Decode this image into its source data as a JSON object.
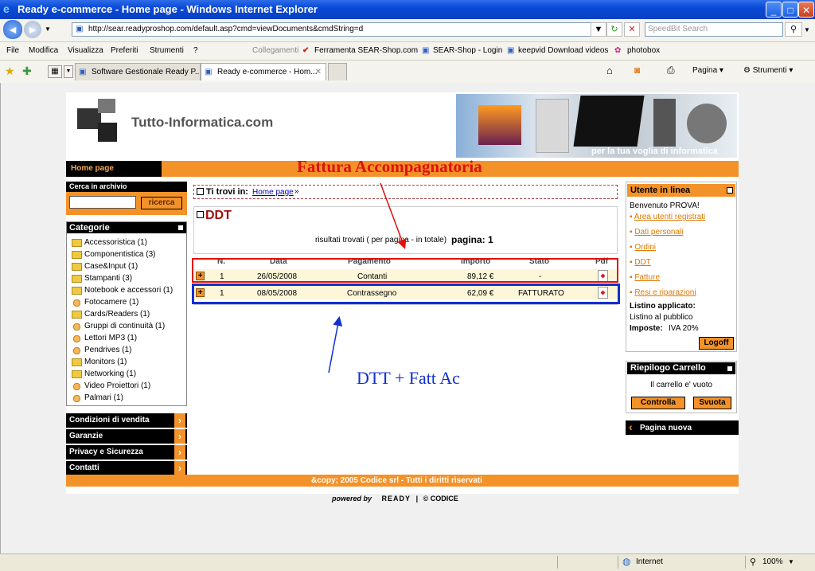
{
  "window": {
    "title": "Ready e-commerce - Home page - Windows Internet Explorer"
  },
  "addressbar": {
    "url": "http://sear.readyproshop.com/default.asp?cmd=viewDocuments&cmdString=d",
    "search_placeholder": "SpeedBit Search"
  },
  "menubar": {
    "items": [
      "File",
      "Modifica",
      "Visualizza",
      "Preferiti",
      "Strumenti",
      "?"
    ],
    "links_label": "Collegamenti",
    "links": [
      "Ferramenta SEAR-Shop.com",
      "SEAR-Shop - Login",
      "keepvid Download videos",
      "photobox"
    ]
  },
  "tabs": {
    "items": [
      "Software Gestionale Ready P...",
      "Ready e-commerce - Hom..."
    ],
    "toolbar": [
      "Pagina",
      "Strumenti"
    ]
  },
  "site": {
    "logo_text": "Tutto-Informatica.com",
    "banner_slogan": "per la tua voglia di informatica",
    "nav_home": "Home page",
    "search_label": "Cerca in archivio",
    "search_button": "ricerca",
    "categories_title": "Categorie",
    "categories": [
      "Accessoristica (1)",
      "Componentistica (3)",
      "Case&Input (1)",
      "Stampanti (3)",
      "Notebook e accessori (1)",
      "Fotocamere (1)",
      "Cards/Readers (1)",
      "Gruppi di continuità (1)",
      "Lettori MP3 (1)",
      "Pendrives (1)",
      "Monitors (1)",
      "Networking (1)",
      "Video Proiettori (1)",
      "Palmari (1)"
    ],
    "sidelinks": [
      "Condizioni di vendita",
      "Garanzie",
      "Privacy e Sicurezza",
      "Contatti"
    ],
    "breadcrumb_label": "Ti trovi in:",
    "breadcrumb_link": "Home page",
    "section_title": "DDT",
    "results_text": "risultati trovati ( per pagina - in totale)",
    "page_label": "pagina: 1",
    "table": {
      "headers": [
        "N.",
        "Data",
        "Pagamento",
        "Importo",
        "Stato",
        "Pdf"
      ],
      "rows": [
        {
          "n": "1",
          "date": "26/05/2008",
          "payment": "Contanti",
          "amount": "89,12 €",
          "status": "-"
        },
        {
          "n": "1",
          "date": "08/05/2008",
          "payment": "Contrassegno",
          "amount": "62,09 €",
          "status": "FATTURATO"
        }
      ]
    },
    "user_box": {
      "title": "Utente in linea",
      "welcome": "Benvenuto PROVA!",
      "links": [
        "Area utenti registrati",
        "Dati personali",
        "Ordini",
        "DDT",
        "Fatture",
        "Resi e riparazioni"
      ],
      "listino_label": "Listino applicato:",
      "listino_value": "Listino al pubblico",
      "imposte_label": "Imposte:",
      "imposte_value": "IVA 20%",
      "logoff": "Logoff"
    },
    "cart_box": {
      "title": "Riepilogo Carrello",
      "empty": "Il carrello e' vuoto",
      "check": "Controlla",
      "empty_button": "Svuota"
    },
    "new_page": "Pagina nuova",
    "footer": "&copy; 2005 Codice srl - Tutti i diritti riservati",
    "powered_by": "powered by",
    "powered_ready": "READY",
    "powered_codice": "© CODICE"
  },
  "annotations": {
    "top_label": "Fattura Accompagnatoria",
    "bottom_label": "DTT + Fatt Ac",
    "top_color": "#e01010",
    "bottom_color": "#1030d0"
  },
  "statusbar": {
    "zone": "Internet",
    "zoom": "100%"
  }
}
